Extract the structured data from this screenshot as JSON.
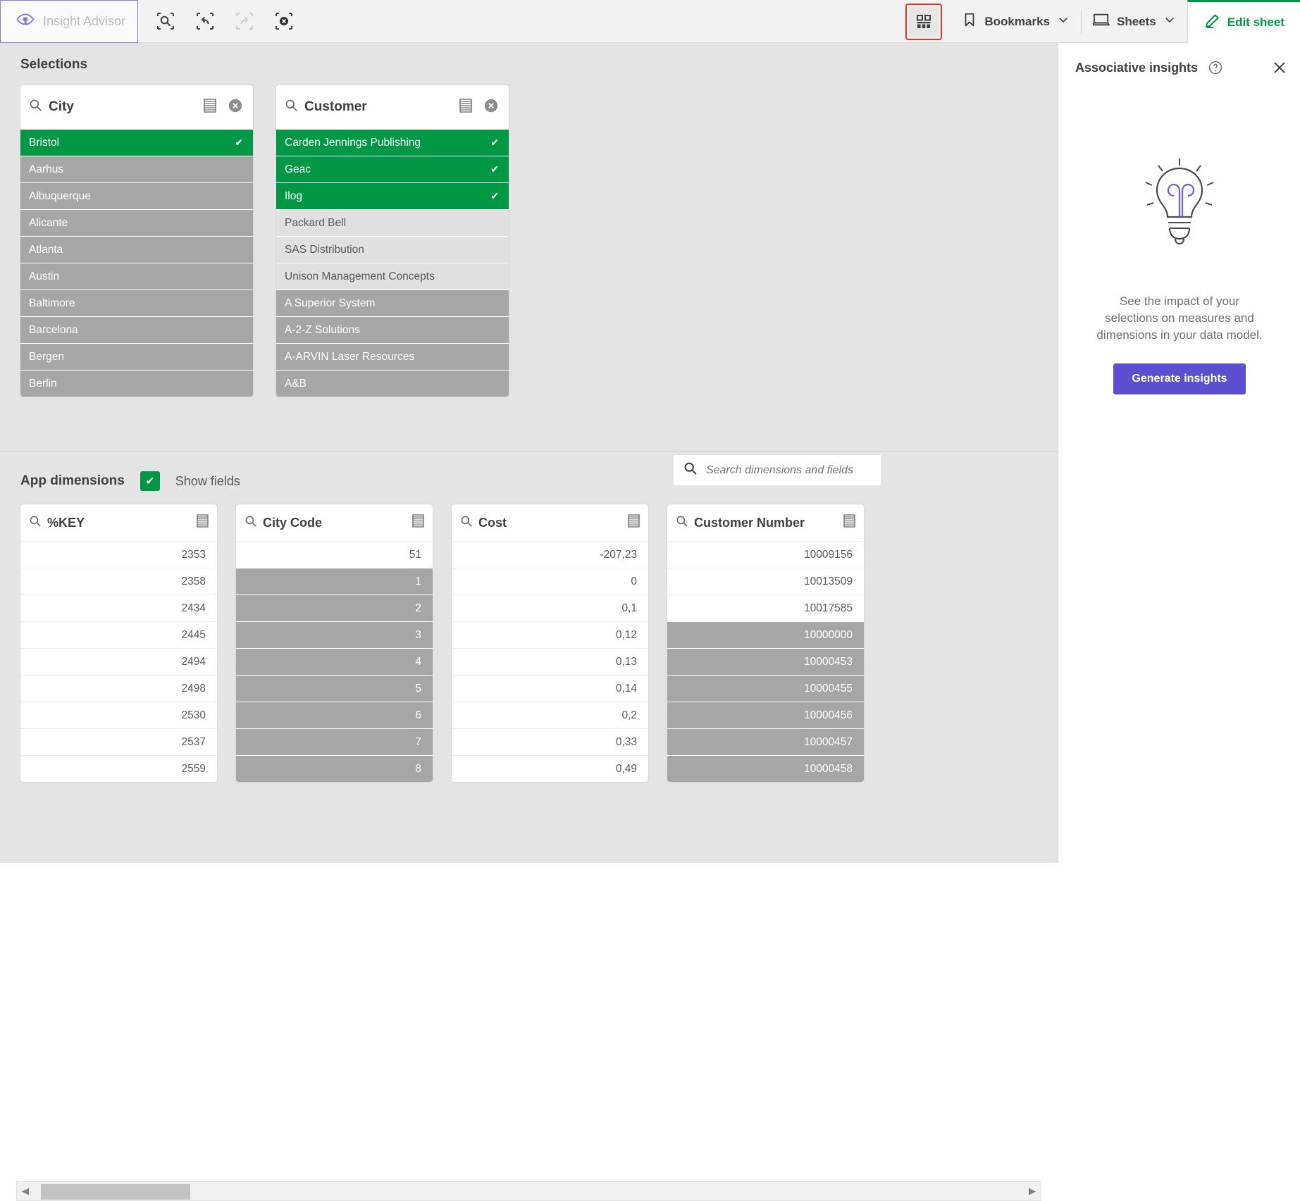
{
  "toolbar": {
    "insight_advisor_label": "Insight Advisor",
    "insight_advisor_icon": "eye-lightbulb-icon",
    "icons": [
      {
        "name": "selection-search-icon",
        "enabled": true
      },
      {
        "name": "step-back-icon",
        "enabled": true
      },
      {
        "name": "step-forward-icon",
        "enabled": false
      },
      {
        "name": "clear-selections-icon",
        "enabled": true
      }
    ],
    "selections_tool_icon": "selections-tool-icon",
    "selections_tool_highlighted": true,
    "highlight_color": "#f4331f",
    "bookmarks_label": "Bookmarks",
    "bookmarks_icon": "bookmark-icon",
    "sheets_label": "Sheets",
    "sheets_icon": "sheet-icon",
    "edit_sheet_label": "Edit sheet",
    "edit_sheet_icon": "pencil-icon",
    "accent_green": "#009845"
  },
  "selections": {
    "title": "Selections",
    "listboxes": [
      {
        "field": "City",
        "search_icon": "search-icon",
        "list_icon": "list-view-icon",
        "clear_icon": "clear-selection-icon",
        "has_clear": true,
        "align": "left",
        "rows": [
          {
            "value": "Bristol",
            "state": "selected",
            "tick": "✔"
          },
          {
            "value": "Aarhus",
            "state": "alt"
          },
          {
            "value": "Albuquerque",
            "state": "alt"
          },
          {
            "value": "Alicante",
            "state": "alt"
          },
          {
            "value": "Atlanta",
            "state": "alt"
          },
          {
            "value": "Austin",
            "state": "alt"
          },
          {
            "value": "Baltimore",
            "state": "alt"
          },
          {
            "value": "Barcelona",
            "state": "alt"
          },
          {
            "value": "Bergen",
            "state": "alt"
          },
          {
            "value": "Berlin",
            "state": "alt"
          }
        ]
      },
      {
        "field": "Customer",
        "search_icon": "search-icon",
        "list_icon": "list-view-icon",
        "clear_icon": "clear-selection-icon",
        "has_clear": true,
        "align": "left",
        "rows": [
          {
            "value": "Carden Jennings Publishing",
            "state": "selected",
            "tick": "✔"
          },
          {
            "value": "Geac",
            "state": "selected",
            "tick": "✔"
          },
          {
            "value": "Ilog",
            "state": "selected",
            "tick": "✔"
          },
          {
            "value": "Packard Bell",
            "state": "excluded"
          },
          {
            "value": "SAS Distribution",
            "state": "excluded"
          },
          {
            "value": "Unison Management Concepts",
            "state": "excluded"
          },
          {
            "value": "A Superior System",
            "state": "alt"
          },
          {
            "value": "A-2-Z Solutions",
            "state": "alt"
          },
          {
            "value": "A-ARVIN Laser Resources",
            "state": "alt"
          },
          {
            "value": "A&B",
            "state": "alt"
          }
        ]
      }
    ]
  },
  "app_dimensions": {
    "title": "App dimensions",
    "show_fields_label": "Show fields",
    "show_fields_checked": true,
    "checkbox_icon": "check-icon",
    "search": {
      "icon": "search-icon",
      "placeholder": "Search dimensions and fields",
      "value": ""
    },
    "fields": [
      {
        "name": "%KEY",
        "search_icon": "search-icon",
        "list_icon": "list-view-icon",
        "rows": [
          {
            "value": "2353",
            "state": "w"
          },
          {
            "value": "2358",
            "state": "w"
          },
          {
            "value": "2434",
            "state": "w"
          },
          {
            "value": "2445",
            "state": "w"
          },
          {
            "value": "2494",
            "state": "w"
          },
          {
            "value": "2498",
            "state": "w"
          },
          {
            "value": "2530",
            "state": "w"
          },
          {
            "value": "2537",
            "state": "w"
          },
          {
            "value": "2559",
            "state": "w"
          }
        ]
      },
      {
        "name": "City Code",
        "search_icon": "search-icon",
        "list_icon": "list-view-icon",
        "rows": [
          {
            "value": "51",
            "state": "w"
          },
          {
            "value": "1",
            "state": "g"
          },
          {
            "value": "2",
            "state": "g"
          },
          {
            "value": "3",
            "state": "g"
          },
          {
            "value": "4",
            "state": "g"
          },
          {
            "value": "5",
            "state": "g"
          },
          {
            "value": "6",
            "state": "g"
          },
          {
            "value": "7",
            "state": "g"
          },
          {
            "value": "8",
            "state": "g"
          }
        ]
      },
      {
        "name": "Cost",
        "search_icon": "search-icon",
        "list_icon": "list-view-icon",
        "rows": [
          {
            "value": "-207,23",
            "state": "w"
          },
          {
            "value": "0",
            "state": "w"
          },
          {
            "value": "0,1",
            "state": "w"
          },
          {
            "value": "0,12",
            "state": "w"
          },
          {
            "value": "0,13",
            "state": "w"
          },
          {
            "value": "0,14",
            "state": "w"
          },
          {
            "value": "0,2",
            "state": "w"
          },
          {
            "value": "0,33",
            "state": "w"
          },
          {
            "value": "0,49",
            "state": "w"
          }
        ]
      },
      {
        "name": "Customer Number",
        "search_icon": "search-icon",
        "list_icon": "list-view-icon",
        "rows": [
          {
            "value": "10009156",
            "state": "w"
          },
          {
            "value": "10013509",
            "state": "w"
          },
          {
            "value": "10017585",
            "state": "w"
          },
          {
            "value": "10000000",
            "state": "g"
          },
          {
            "value": "10000453",
            "state": "g"
          },
          {
            "value": "10000455",
            "state": "g"
          },
          {
            "value": "10000456",
            "state": "g"
          },
          {
            "value": "10000457",
            "state": "g"
          },
          {
            "value": "10000458",
            "state": "g"
          }
        ]
      }
    ]
  },
  "associative_insights": {
    "title": "Associative insights",
    "help_icon": "help-circle-icon",
    "close_icon": "close-icon",
    "illustration_icon": "lightbulb-icon",
    "description": "See the impact of your selections on measures and dimensions in your data model.",
    "generate_label": "Generate insights",
    "generate_color": "#5b4fcf"
  }
}
